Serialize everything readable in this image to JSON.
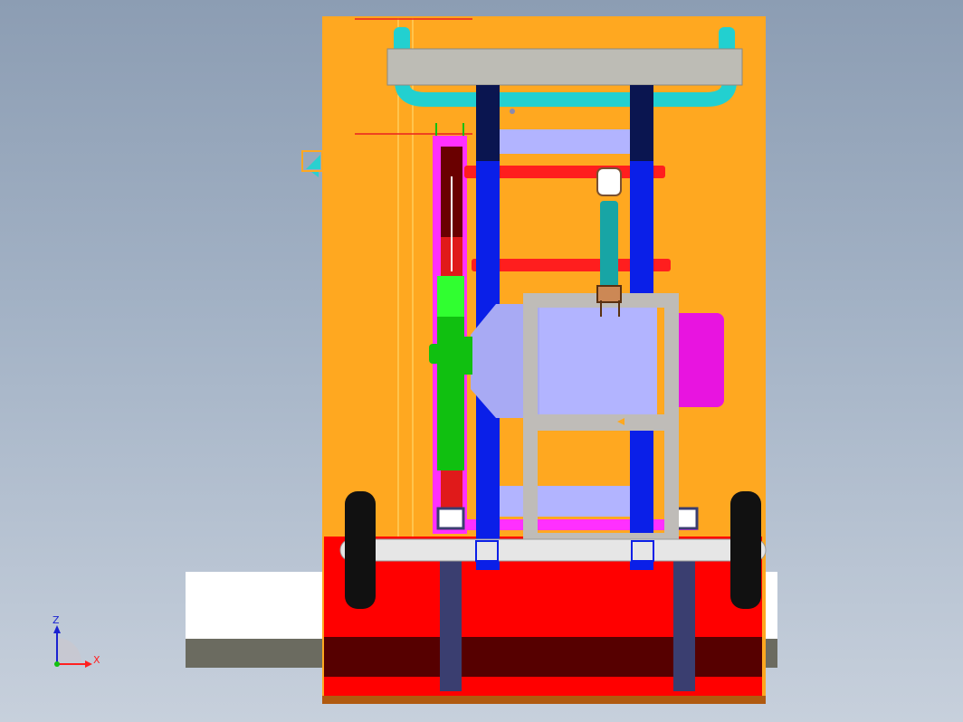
{
  "viewport": {
    "background_top": "#8c9db3",
    "background_bottom": "#c7d0dc"
  },
  "model": {
    "frame_color": "#ffa820",
    "upright_color": "#0a1fe8",
    "upright_cap_color": "#0a1550",
    "crossbar_color": "#ff1e1e",
    "handle_color": "#bdbcb5",
    "handle_tube_color": "#22d0d0",
    "motor_color": "#b2b4ff",
    "motor_cap_color": "#e814e0",
    "belt_guard_color": "#ff30ff",
    "pulley_color": "#10c010",
    "bracket_color": "#bfbcb8",
    "link_color": "#18a5a5",
    "base_color": "#ff0000",
    "base_dark_color": "#560000",
    "axle_color": "#e6e6e6",
    "wheel_color": "#111111",
    "platform_color": "#ffffff",
    "platform_shadow_color": "#6b6b60"
  },
  "view_cube": {
    "icon": "view-orientation-icon",
    "color": "#ffa820"
  },
  "triad": {
    "z_label": "Z",
    "x_label": "X",
    "z_color": "#1a22d0",
    "x_color": "#ff2020"
  }
}
